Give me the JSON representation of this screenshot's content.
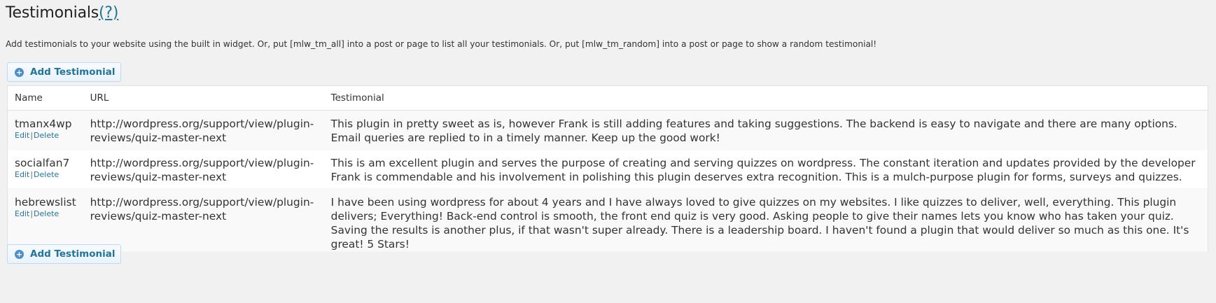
{
  "header": {
    "title": "Testimonials",
    "help_link": "(?)",
    "description": "Add testimonials to your website using the built in widget. Or, put [mlw_tm_all] into a post or page to list all your testimonials. Or, put [mlw_tm_random] into a post or page to show a random testimonial!"
  },
  "buttons": {
    "add_label": "Add Testimonial"
  },
  "table": {
    "columns": [
      "Name",
      "URL",
      "Testimonial"
    ],
    "actions": {
      "edit": "Edit",
      "separator": "|",
      "delete": "Delete"
    },
    "rows": [
      {
        "name": "tmanx4wp",
        "url": "http://wordpress.org/support/view/plugin-reviews/quiz-master-next",
        "testimonial": "This plugin in pretty sweet as is, however Frank is still adding features and taking suggestions. The backend is easy to navigate and there are many options. Email queries are replied to in a timely manner. Keep up the good work!"
      },
      {
        "name": "socialfan7",
        "url": "http://wordpress.org/support/view/plugin-reviews/quiz-master-next",
        "testimonial": "This is am excellent plugin and serves the purpose of creating and serving quizzes on wordpress. The constant iteration and updates provided by the developer Frank is commendable and his involvement in polishing this plugin deserves extra recognition. This is a mulch-purpose plugin for forms, surveys and quizzes."
      },
      {
        "name": "hebrewslist",
        "url": "http://wordpress.org/support/view/plugin-reviews/quiz-master-next",
        "testimonial": "I have been using wordpress for about 4 years and I have always loved to give quizzes on my websites. I like quizzes to deliver, well, everything. This plugin delivers; Everything! Back-end control is smooth, the front end quiz is very good. Asking people to give their names lets you know who has taken your quiz. Saving the results is another plus, if that wasn't super already. There is a leadership board. I haven't found a plugin that would deliver so much as this one. It's great! 5 Stars!"
      }
    ]
  },
  "colors": {
    "link": "#21759b",
    "page_bg": "#f1f1f1",
    "button_border": "#bfd9ee",
    "plus_icon": "#4d8fc7"
  }
}
